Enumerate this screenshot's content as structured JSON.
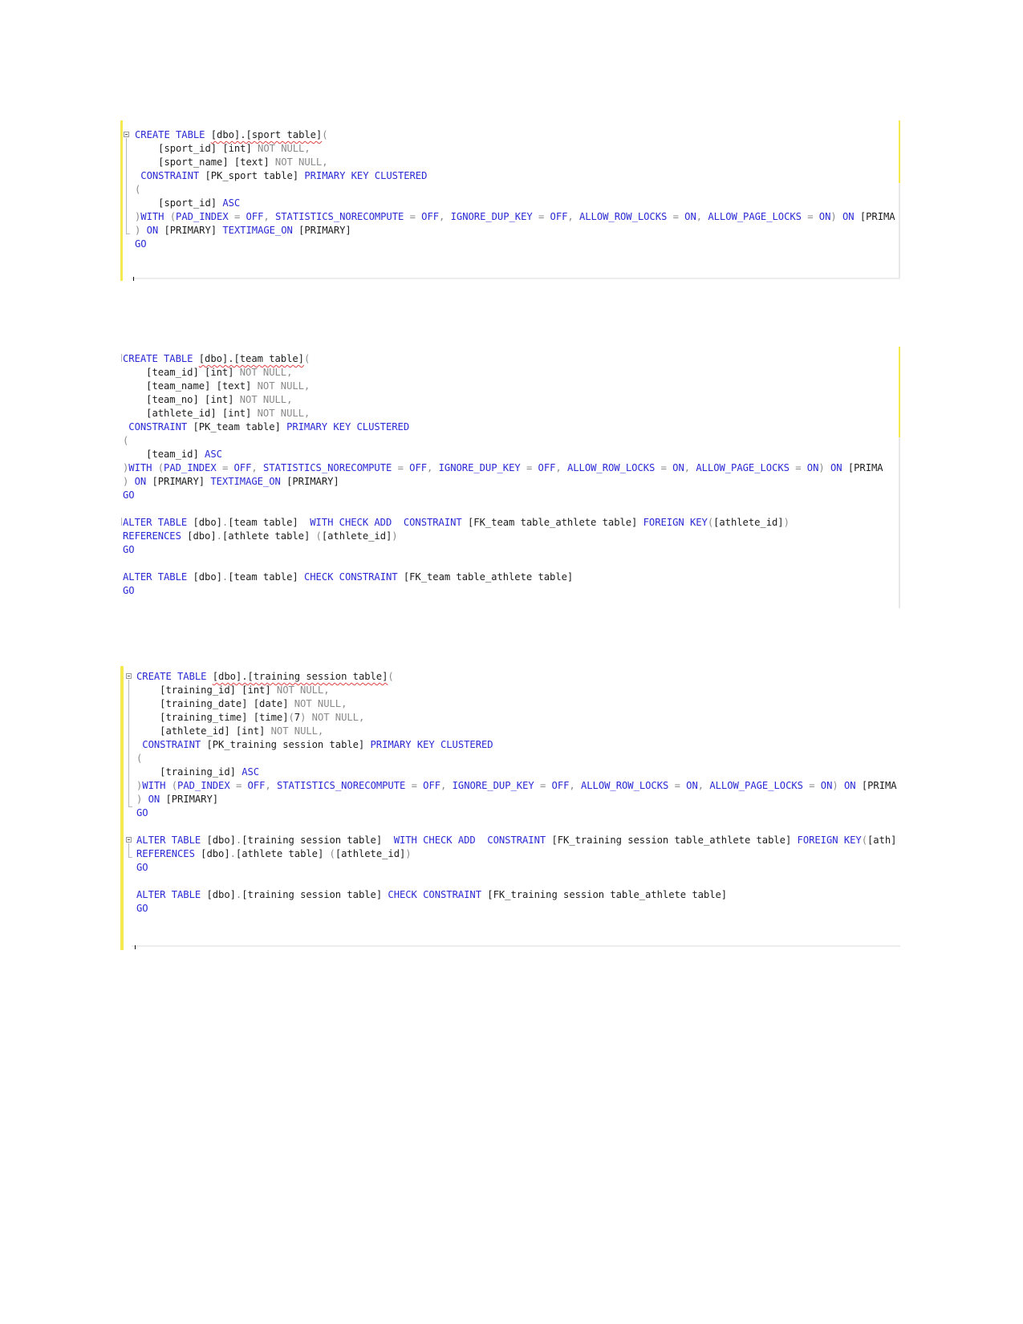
{
  "colors": {
    "keyword": "#2a2ad6",
    "identifier": "#1c1c1c",
    "operator_gray": "#8a8a8a",
    "change_marker_yellow": "#f6e94f",
    "squiggle_red": "#e04040"
  },
  "panels": [
    {
      "name": "sport-table-script",
      "lines": [
        [
          {
            "t": "CREATE TABLE ",
            "c": "kw"
          },
          {
            "t": "[dbo].[sport table]",
            "c": "sq"
          },
          {
            "t": "(",
            "c": "gr"
          }
        ],
        [
          {
            "t": "    [sport_id] [int] ",
            "c": "tx"
          },
          {
            "t": "NOT NULL,",
            "c": "gr"
          }
        ],
        [
          {
            "t": "    [sport_name] [text] ",
            "c": "tx"
          },
          {
            "t": "NOT NULL,",
            "c": "gr"
          }
        ],
        [
          {
            "t": " CONSTRAINT ",
            "c": "kw"
          },
          {
            "t": "[PK_sport table] ",
            "c": "tx"
          },
          {
            "t": "PRIMARY KEY CLUSTERED",
            "c": "kw"
          }
        ],
        [
          {
            "t": "(",
            "c": "gr"
          }
        ],
        [
          {
            "t": "    [sport_id] ",
            "c": "tx"
          },
          {
            "t": "ASC",
            "c": "kw"
          }
        ],
        [
          {
            "t": ")",
            "c": "gr"
          },
          {
            "t": "WITH ",
            "c": "kw"
          },
          {
            "t": "(",
            "c": "gr"
          },
          {
            "t": "PAD_INDEX ",
            "c": "kw"
          },
          {
            "t": "= ",
            "c": "gr"
          },
          {
            "t": "OFF",
            "c": "kw"
          },
          {
            "t": ", ",
            "c": "gr"
          },
          {
            "t": "STATISTICS_NORECOMPUTE ",
            "c": "kw"
          },
          {
            "t": "= ",
            "c": "gr"
          },
          {
            "t": "OFF",
            "c": "kw"
          },
          {
            "t": ", ",
            "c": "gr"
          },
          {
            "t": "IGNORE_DUP_KEY ",
            "c": "kw"
          },
          {
            "t": "= ",
            "c": "gr"
          },
          {
            "t": "OFF",
            "c": "kw"
          },
          {
            "t": ", ",
            "c": "gr"
          },
          {
            "t": "ALLOW_ROW_LOCKS ",
            "c": "kw"
          },
          {
            "t": "= ",
            "c": "gr"
          },
          {
            "t": "ON",
            "c": "kw"
          },
          {
            "t": ", ",
            "c": "gr"
          },
          {
            "t": "ALLOW_PAGE_LOCKS ",
            "c": "kw"
          },
          {
            "t": "= ",
            "c": "gr"
          },
          {
            "t": "ON",
            "c": "kw"
          },
          {
            "t": ") ",
            "c": "gr"
          },
          {
            "t": "ON ",
            "c": "kw"
          },
          {
            "t": "[PRIMA",
            "c": "tx"
          }
        ],
        [
          {
            "t": ") ",
            "c": "gr"
          },
          {
            "t": "ON ",
            "c": "kw"
          },
          {
            "t": "[PRIMARY] ",
            "c": "tx"
          },
          {
            "t": "TEXTIMAGE_ON ",
            "c": "kw"
          },
          {
            "t": "[PRIMARY]",
            "c": "tx"
          }
        ],
        [
          {
            "t": "GO",
            "c": "kw"
          }
        ]
      ]
    },
    {
      "name": "team-table-script",
      "lines": [
        [
          {
            "t": "CREATE TABLE ",
            "c": "kw"
          },
          {
            "t": "[dbo].[team table]",
            "c": "sq"
          },
          {
            "t": "(",
            "c": "gr"
          }
        ],
        [
          {
            "t": "    [team_id] [int] ",
            "c": "tx"
          },
          {
            "t": "NOT NULL,",
            "c": "gr"
          }
        ],
        [
          {
            "t": "    [team_name] [text] ",
            "c": "tx"
          },
          {
            "t": "NOT NULL,",
            "c": "gr"
          }
        ],
        [
          {
            "t": "    [team_no] [int] ",
            "c": "tx"
          },
          {
            "t": "NOT NULL,",
            "c": "gr"
          }
        ],
        [
          {
            "t": "    [athlete_id] [int] ",
            "c": "tx"
          },
          {
            "t": "NOT NULL,",
            "c": "gr"
          }
        ],
        [
          {
            "t": " CONSTRAINT ",
            "c": "kw"
          },
          {
            "t": "[PK_team table] ",
            "c": "tx"
          },
          {
            "t": "PRIMARY KEY CLUSTERED",
            "c": "kw"
          }
        ],
        [
          {
            "t": "(",
            "c": "gr"
          }
        ],
        [
          {
            "t": "    [team_id] ",
            "c": "tx"
          },
          {
            "t": "ASC",
            "c": "kw"
          }
        ],
        [
          {
            "t": ")",
            "c": "gr"
          },
          {
            "t": "WITH ",
            "c": "kw"
          },
          {
            "t": "(",
            "c": "gr"
          },
          {
            "t": "PAD_INDEX ",
            "c": "kw"
          },
          {
            "t": "= ",
            "c": "gr"
          },
          {
            "t": "OFF",
            "c": "kw"
          },
          {
            "t": ", ",
            "c": "gr"
          },
          {
            "t": "STATISTICS_NORECOMPUTE ",
            "c": "kw"
          },
          {
            "t": "= ",
            "c": "gr"
          },
          {
            "t": "OFF",
            "c": "kw"
          },
          {
            "t": ", ",
            "c": "gr"
          },
          {
            "t": "IGNORE_DUP_KEY ",
            "c": "kw"
          },
          {
            "t": "= ",
            "c": "gr"
          },
          {
            "t": "OFF",
            "c": "kw"
          },
          {
            "t": ", ",
            "c": "gr"
          },
          {
            "t": "ALLOW_ROW_LOCKS ",
            "c": "kw"
          },
          {
            "t": "= ",
            "c": "gr"
          },
          {
            "t": "ON",
            "c": "kw"
          },
          {
            "t": ", ",
            "c": "gr"
          },
          {
            "t": "ALLOW_PAGE_LOCKS ",
            "c": "kw"
          },
          {
            "t": "= ",
            "c": "gr"
          },
          {
            "t": "ON",
            "c": "kw"
          },
          {
            "t": ") ",
            "c": "gr"
          },
          {
            "t": "ON ",
            "c": "kw"
          },
          {
            "t": "[PRIMA",
            "c": "tx"
          }
        ],
        [
          {
            "t": ") ",
            "c": "gr"
          },
          {
            "t": "ON ",
            "c": "kw"
          },
          {
            "t": "[PRIMARY] ",
            "c": "tx"
          },
          {
            "t": "TEXTIMAGE_ON ",
            "c": "kw"
          },
          {
            "t": "[PRIMARY]",
            "c": "tx"
          }
        ],
        [
          {
            "t": "GO",
            "c": "kw"
          }
        ],
        [],
        [
          {
            "t": "ALTER TABLE ",
            "c": "kw"
          },
          {
            "t": "[dbo]",
            "c": "tx"
          },
          {
            "t": ".",
            "c": "gr"
          },
          {
            "t": "[team table]  ",
            "c": "tx"
          },
          {
            "t": "WITH CHECK ADD  CONSTRAINT ",
            "c": "kw"
          },
          {
            "t": "[FK_team table_athlete table] ",
            "c": "tx"
          },
          {
            "t": "FOREIGN KEY",
            "c": "kw"
          },
          {
            "t": "(",
            "c": "gr"
          },
          {
            "t": "[athlete_id]",
            "c": "tx"
          },
          {
            "t": ")",
            "c": "gr"
          }
        ],
        [
          {
            "t": "REFERENCES ",
            "c": "kw"
          },
          {
            "t": "[dbo]",
            "c": "tx"
          },
          {
            "t": ".",
            "c": "gr"
          },
          {
            "t": "[athlete table] ",
            "c": "tx"
          },
          {
            "t": "(",
            "c": "gr"
          },
          {
            "t": "[athlete_id]",
            "c": "tx"
          },
          {
            "t": ")",
            "c": "gr"
          }
        ],
        [
          {
            "t": "GO",
            "c": "kw"
          }
        ],
        [],
        [
          {
            "t": "ALTER TABLE ",
            "c": "kw"
          },
          {
            "t": "[dbo]",
            "c": "tx"
          },
          {
            "t": ".",
            "c": "gr"
          },
          {
            "t": "[team table] ",
            "c": "tx"
          },
          {
            "t": "CHECK CONSTRAINT ",
            "c": "kw"
          },
          {
            "t": "[FK_team table_athlete table]",
            "c": "tx"
          }
        ],
        [
          {
            "t": "GO",
            "c": "kw"
          }
        ]
      ]
    },
    {
      "name": "training-session-table-script",
      "lines": [
        [
          {
            "t": "CREATE TABLE ",
            "c": "kw"
          },
          {
            "t": "[dbo].[training session table]",
            "c": "sq"
          },
          {
            "t": "(",
            "c": "gr"
          }
        ],
        [
          {
            "t": "    [training_id] [int] ",
            "c": "tx"
          },
          {
            "t": "NOT NULL,",
            "c": "gr"
          }
        ],
        [
          {
            "t": "    [training_date] [date] ",
            "c": "tx"
          },
          {
            "t": "NOT NULL,",
            "c": "gr"
          }
        ],
        [
          {
            "t": "    [training_time] [time]",
            "c": "tx"
          },
          {
            "t": "(",
            "c": "gr"
          },
          {
            "t": "7",
            "c": "tx"
          },
          {
            "t": ") NOT NULL,",
            "c": "gr"
          }
        ],
        [
          {
            "t": "    [athlete_id] [int] ",
            "c": "tx"
          },
          {
            "t": "NOT NULL,",
            "c": "gr"
          }
        ],
        [
          {
            "t": " CONSTRAINT ",
            "c": "kw"
          },
          {
            "t": "[PK_training session table] ",
            "c": "tx"
          },
          {
            "t": "PRIMARY KEY CLUSTERED",
            "c": "kw"
          }
        ],
        [
          {
            "t": "(",
            "c": "gr"
          }
        ],
        [
          {
            "t": "    [training_id] ",
            "c": "tx"
          },
          {
            "t": "ASC",
            "c": "kw"
          }
        ],
        [
          {
            "t": ")",
            "c": "gr"
          },
          {
            "t": "WITH ",
            "c": "kw"
          },
          {
            "t": "(",
            "c": "gr"
          },
          {
            "t": "PAD_INDEX ",
            "c": "kw"
          },
          {
            "t": "= ",
            "c": "gr"
          },
          {
            "t": "OFF",
            "c": "kw"
          },
          {
            "t": ", ",
            "c": "gr"
          },
          {
            "t": "STATISTICS_NORECOMPUTE ",
            "c": "kw"
          },
          {
            "t": "= ",
            "c": "gr"
          },
          {
            "t": "OFF",
            "c": "kw"
          },
          {
            "t": ", ",
            "c": "gr"
          },
          {
            "t": "IGNORE_DUP_KEY ",
            "c": "kw"
          },
          {
            "t": "= ",
            "c": "gr"
          },
          {
            "t": "OFF",
            "c": "kw"
          },
          {
            "t": ", ",
            "c": "gr"
          },
          {
            "t": "ALLOW_ROW_LOCKS ",
            "c": "kw"
          },
          {
            "t": "= ",
            "c": "gr"
          },
          {
            "t": "ON",
            "c": "kw"
          },
          {
            "t": ", ",
            "c": "gr"
          },
          {
            "t": "ALLOW_PAGE_LOCKS ",
            "c": "kw"
          },
          {
            "t": "= ",
            "c": "gr"
          },
          {
            "t": "ON",
            "c": "kw"
          },
          {
            "t": ") ",
            "c": "gr"
          },
          {
            "t": "ON ",
            "c": "kw"
          },
          {
            "t": "[PRIMA",
            "c": "tx"
          }
        ],
        [
          {
            "t": ") ",
            "c": "gr"
          },
          {
            "t": "ON ",
            "c": "kw"
          },
          {
            "t": "[PRIMARY]",
            "c": "tx"
          }
        ],
        [
          {
            "t": "GO",
            "c": "kw"
          }
        ],
        [],
        [
          {
            "t": "ALTER TABLE ",
            "c": "kw"
          },
          {
            "t": "[dbo]",
            "c": "tx"
          },
          {
            "t": ".",
            "c": "gr"
          },
          {
            "t": "[training session table]  ",
            "c": "tx"
          },
          {
            "t": "WITH CHECK ADD  CONSTRAINT ",
            "c": "kw"
          },
          {
            "t": "[FK_training session table_athlete table] ",
            "c": "tx"
          },
          {
            "t": "FOREIGN KEY",
            "c": "kw"
          },
          {
            "t": "(",
            "c": "gr"
          },
          {
            "t": "[ath]",
            "c": "tx"
          }
        ],
        [
          {
            "t": "REFERENCES ",
            "c": "kw"
          },
          {
            "t": "[dbo]",
            "c": "tx"
          },
          {
            "t": ".",
            "c": "gr"
          },
          {
            "t": "[athlete table] ",
            "c": "tx"
          },
          {
            "t": "(",
            "c": "gr"
          },
          {
            "t": "[athlete_id]",
            "c": "tx"
          },
          {
            "t": ")",
            "c": "gr"
          }
        ],
        [
          {
            "t": "GO",
            "c": "kw"
          }
        ],
        [],
        [
          {
            "t": "ALTER TABLE ",
            "c": "kw"
          },
          {
            "t": "[dbo]",
            "c": "tx"
          },
          {
            "t": ".",
            "c": "gr"
          },
          {
            "t": "[training session table] ",
            "c": "tx"
          },
          {
            "t": "CHECK CONSTRAINT ",
            "c": "kw"
          },
          {
            "t": "[FK_training session table_athlete table]",
            "c": "tx"
          }
        ],
        [
          {
            "t": "GO",
            "c": "kw"
          }
        ]
      ]
    }
  ]
}
